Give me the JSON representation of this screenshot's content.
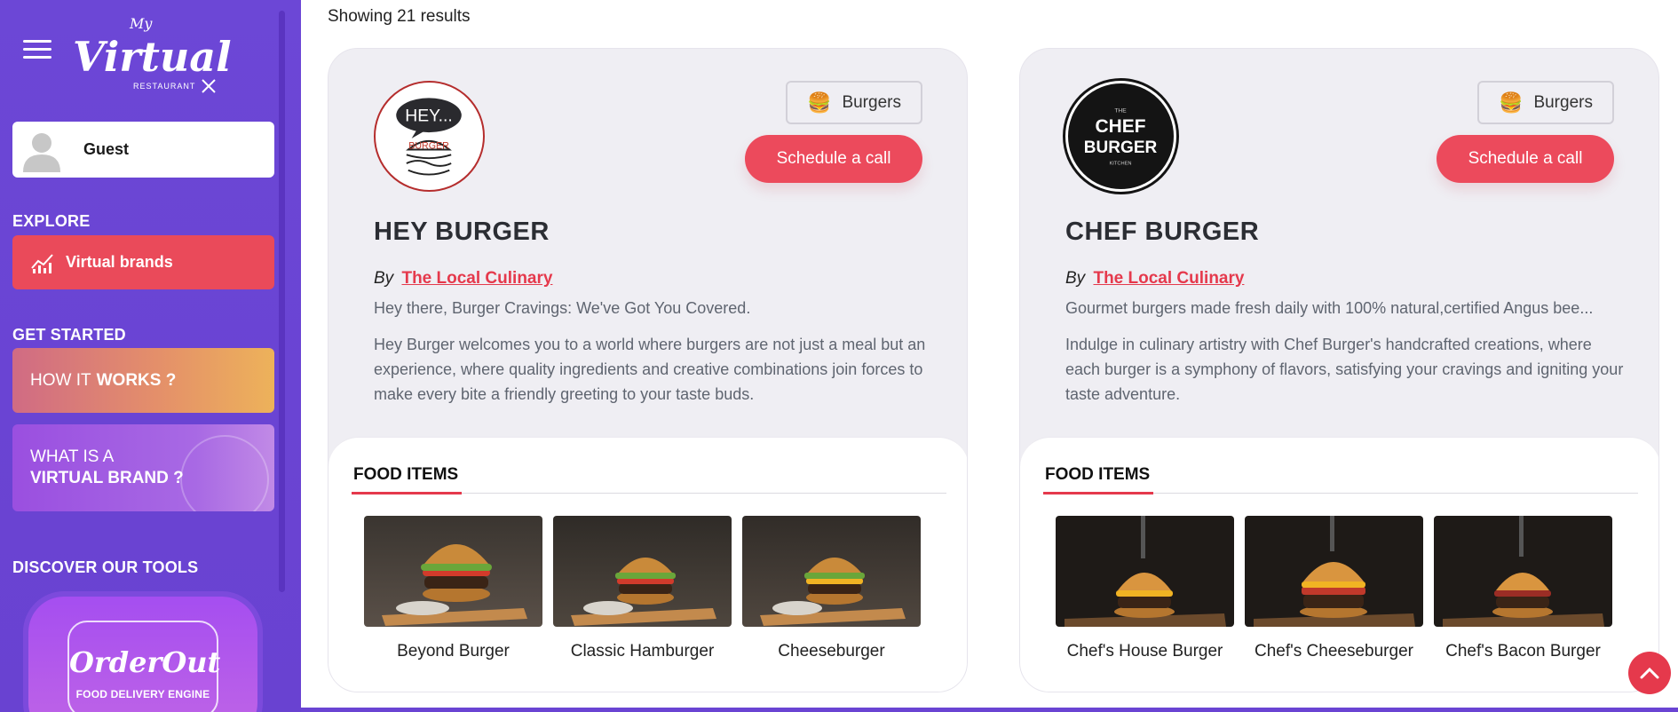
{
  "sidebar": {
    "logo_top": "My",
    "logo_main": "Virtual",
    "logo_sub": "RESTAURANT",
    "guest_name": "Guest",
    "explore_heading": "EXPLORE",
    "virtual_brands_label": "Virtual brands",
    "get_started_heading": "GET STARTED",
    "how_it_works": {
      "prefix": "HOW IT",
      "bold": "WORKS ?"
    },
    "what_is": {
      "line1": "WHAT IS A",
      "line2": "VIRTUAL BRAND ?"
    },
    "tools_heading": "DISCOVER OUR TOOLS",
    "tool": {
      "name": "OrderOut",
      "subtitle": "FOOD DELIVERY ENGINE"
    }
  },
  "main": {
    "results_text": "Showing 21 results",
    "cards": [
      {
        "category": "Burgers",
        "category_icon": "burger-emoji",
        "schedule_label": "Schedule a call",
        "title": "HEY BURGER",
        "by_prefix": "By",
        "by_link": "The Local Culinary",
        "tagline": "Hey there, Burger Cravings: We've Got You Covered.",
        "description": "Hey Burger welcomes you to a world where burgers are not just a meal but an experience, where quality ingredients and creative combinations join forces to make every bite a friendly greeting to your taste buds.",
        "food_heading": "FOOD ITEMS",
        "food_items": [
          "Beyond Burger",
          "Classic Hamburger",
          "Cheeseburger"
        ]
      },
      {
        "category": "Burgers",
        "category_icon": "burger-emoji",
        "schedule_label": "Schedule a call",
        "title": "CHEF BURGER",
        "by_prefix": "By",
        "by_link": "The Local Culinary",
        "tagline": "Gourmet burgers made fresh daily with 100% natural,certified Angus bee...",
        "description": "Indulge in culinary artistry with Chef Burger's handcrafted creations, where each burger is a symphony of flavors, satisfying your cravings and igniting your taste adventure.",
        "food_heading": "FOOD ITEMS",
        "food_items": [
          "Chef's House Burger",
          "Chef's Cheeseburger",
          "Chef's Bacon Burger"
        ]
      }
    ]
  },
  "colors": {
    "sidebar_bg": "#6a44d3",
    "accent_red": "#e5394c",
    "card_bg": "#efeef3"
  }
}
